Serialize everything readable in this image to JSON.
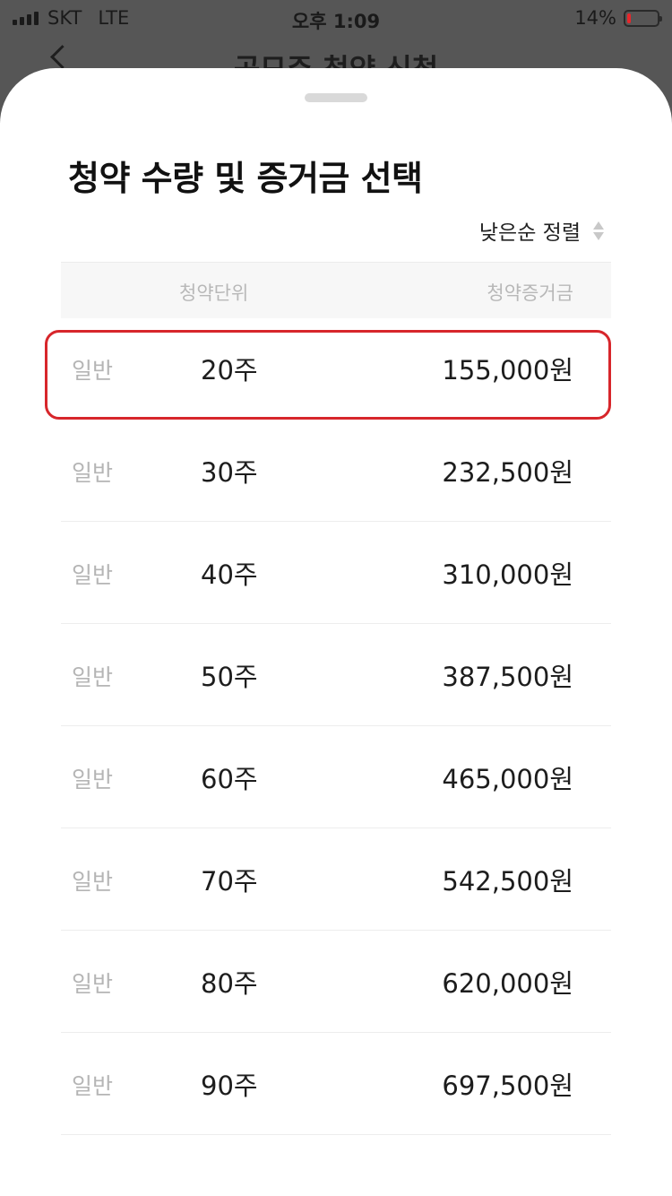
{
  "status_bar": {
    "carrier": "SKT",
    "network": "LTE",
    "time": "오후 1:09",
    "battery_percent": "14%",
    "battery_level": 0.14,
    "battery_color": "#e8262b"
  },
  "behind_header": {
    "title": "공모주 청약 신청"
  },
  "sheet": {
    "title": "청약 수량 및 증거금 선택",
    "sort_label": "낮은순 정렬",
    "columns": {
      "unit": "청약단위",
      "deposit": "청약증거금"
    },
    "selected_index": 0,
    "highlight_color": "#d7262b",
    "rows": [
      {
        "type": "일반",
        "unit": "20주",
        "deposit": "155,000원"
      },
      {
        "type": "일반",
        "unit": "30주",
        "deposit": "232,500원"
      },
      {
        "type": "일반",
        "unit": "40주",
        "deposit": "310,000원"
      },
      {
        "type": "일반",
        "unit": "50주",
        "deposit": "387,500원"
      },
      {
        "type": "일반",
        "unit": "60주",
        "deposit": "465,000원"
      },
      {
        "type": "일반",
        "unit": "70주",
        "deposit": "542,500원"
      },
      {
        "type": "일반",
        "unit": "80주",
        "deposit": "620,000원"
      },
      {
        "type": "일반",
        "unit": "90주",
        "deposit": "697,500원"
      }
    ]
  }
}
